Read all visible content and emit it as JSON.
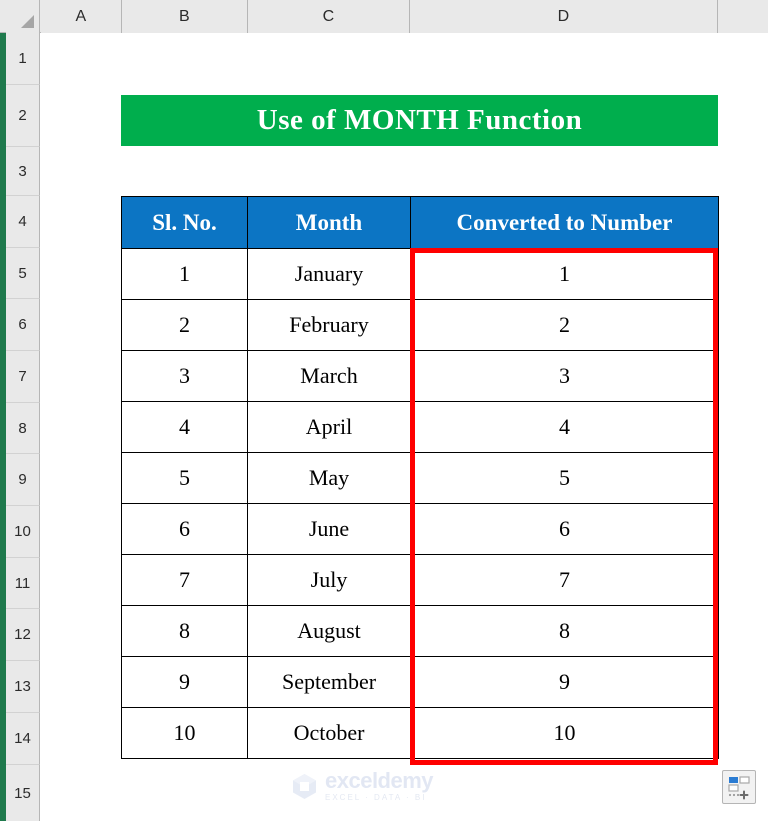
{
  "app": {
    "type": "spreadsheet",
    "column_headers": [
      "A",
      "B",
      "C",
      "D"
    ],
    "row_headers": [
      "1",
      "2",
      "3",
      "4",
      "5",
      "6",
      "7",
      "8",
      "9",
      "10",
      "11",
      "12",
      "13",
      "14",
      "15"
    ]
  },
  "title_banner": {
    "text": "Use of MONTH Function",
    "background_color": "#00AE4D",
    "text_color": "#FFFFFF"
  },
  "table": {
    "header_background": "#0C75C4",
    "header_text_color": "#FFFFFF",
    "columns": [
      "Sl. No.",
      "Month",
      "Converted to Number"
    ],
    "rows": [
      {
        "sl_no": "1",
        "month": "January",
        "number": "1"
      },
      {
        "sl_no": "2",
        "month": "February",
        "number": "2"
      },
      {
        "sl_no": "3",
        "month": "March",
        "number": "3"
      },
      {
        "sl_no": "4",
        "month": "April",
        "number": "4"
      },
      {
        "sl_no": "5",
        "month": "May",
        "number": "5"
      },
      {
        "sl_no": "6",
        "month": "June",
        "number": "6"
      },
      {
        "sl_no": "7",
        "month": "July",
        "number": "7"
      },
      {
        "sl_no": "8",
        "month": "August",
        "number": "8"
      },
      {
        "sl_no": "9",
        "month": "September",
        "number": "9"
      },
      {
        "sl_no": "10",
        "month": "October",
        "number": "10"
      }
    ]
  },
  "highlight": {
    "color": "#FF0000",
    "target_column": "Converted to Number"
  },
  "watermark": {
    "name": "exceldemy",
    "tagline": "EXCEL · DATA · BI"
  },
  "quick_analysis": {
    "icon": "quick-analysis-icon"
  }
}
